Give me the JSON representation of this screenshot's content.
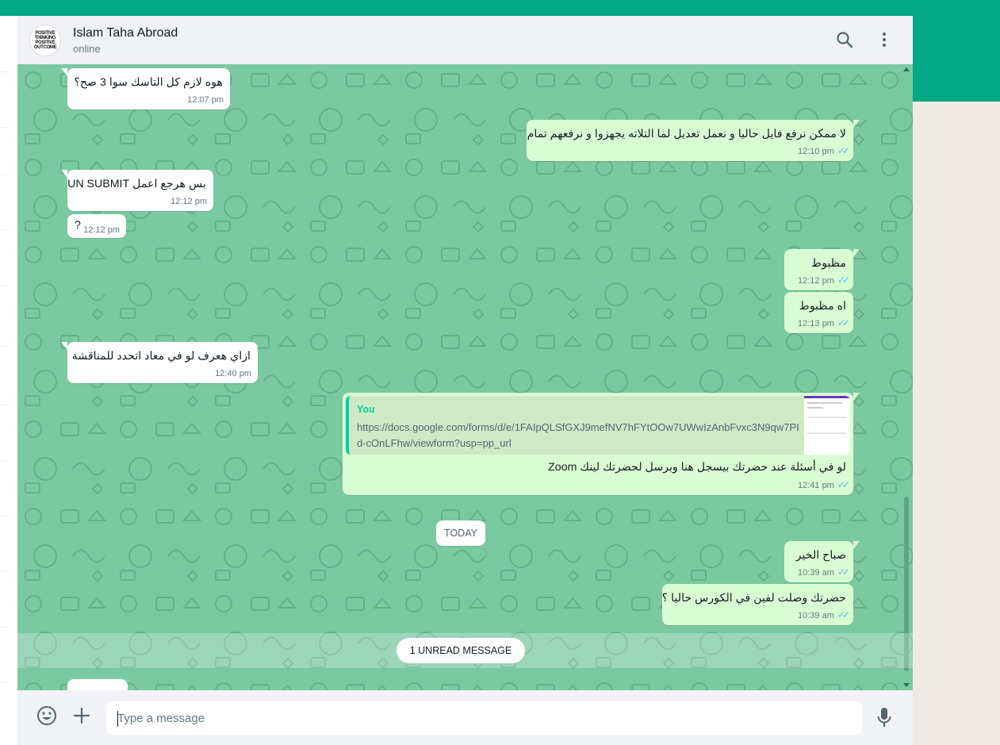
{
  "header": {
    "avatar_lines": [
      "POSITIVE",
      "THINKING",
      "POSITIVE",
      "OUTCOME"
    ],
    "contact_name": "Islam Taha Abroad",
    "status": "online",
    "search_icon": "search-icon",
    "menu_icon": "menu-dots-icon"
  },
  "messages": [
    {
      "direction": "in",
      "text": "هوه لازم كل التاسك سوا 3  صح؟",
      "time": "12:07 pm"
    },
    {
      "direction": "out",
      "text": "لا ممكن نرفع فايل حاليا و نعمل تعديل لما التلاته يجهزوا و نرفعهم تمام",
      "time": "12:10 pm"
    },
    {
      "direction": "in",
      "text": "بس هرجع اعمل UN SUBMIT",
      "time": "12:12 pm"
    },
    {
      "direction": "in",
      "text": "?",
      "time": "12:12 pm"
    },
    {
      "direction": "out",
      "text": "مظبوط",
      "time": "12:12 pm"
    },
    {
      "direction": "out",
      "text": "اه مظبوط",
      "time": "12:13 pm"
    },
    {
      "direction": "in",
      "text": "ازاي هعرف لو في معاد اتحدد للمناقشة",
      "time": "12:40 pm"
    },
    {
      "direction": "out",
      "quote_author": "You",
      "quote_url": "https://docs.google.com/forms/d/e/1FAIpQLSfGXJ9mefNV7hFYtOOw7UWwIzAnbFvxc3N9qw7PId-cOnLFhw/viewform?usp=pp_url",
      "text": "لو في أسئلة عند حضرتك بيسجل هنا وبرسل لحضرتك لينك Zoom",
      "time": "12:41 pm"
    },
    {
      "direction": "out",
      "text": "صباح الخير",
      "time": "10:39 am"
    },
    {
      "direction": "out",
      "text": "حضرتك وصلت لفين في الكورس حاليا ؟",
      "time": "10:39 am"
    }
  ],
  "date_divider": "TODAY",
  "unread_divider": "1 UNREAD MESSAGE",
  "composer": {
    "placeholder": "Type a message",
    "emoji_icon": "emoji-icon",
    "attach_icon": "plus-icon",
    "mic_icon": "microphone-icon"
  },
  "colors": {
    "brand": "#00a884",
    "chat_bg": "#7bc9a0",
    "outgoing_bubble": "#d9fdd3",
    "incoming_bubble": "#ffffff",
    "read_ticks": "#53bdeb"
  }
}
